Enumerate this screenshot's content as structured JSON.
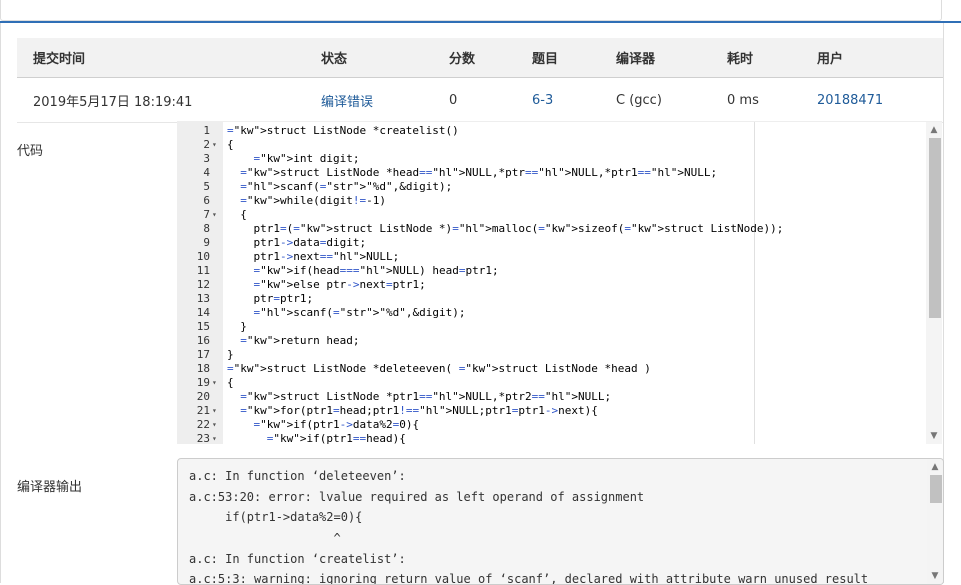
{
  "table": {
    "headers": [
      "提交时间",
      "状态",
      "分数",
      "题目",
      "编译器",
      "耗时",
      "用户"
    ],
    "row": {
      "time": "2019年5月17日 18:19:41",
      "status": "编译错误",
      "score": "0",
      "problem": "6-3",
      "compiler": "C (gcc)",
      "elapsed": "0 ms",
      "user": "20188471"
    }
  },
  "labels": {
    "code": "代码",
    "compiler_output": "编译器输出"
  },
  "code_lines": [
    {
      "n": "1",
      "fold": "",
      "t": "struct ListNode *createlist()"
    },
    {
      "n": "2",
      "fold": "▾",
      "t": "{"
    },
    {
      "n": "3",
      "fold": "",
      "t": "    int digit;"
    },
    {
      "n": "4",
      "fold": "",
      "t": "  struct ListNode *head=NULL,*ptr=NULL,*ptr1=NULL;"
    },
    {
      "n": "5",
      "fold": "",
      "t": "  scanf(\"%d\",&digit);"
    },
    {
      "n": "6",
      "fold": "",
      "t": "  while(digit!=-1)"
    },
    {
      "n": "7",
      "fold": "▾",
      "t": "  {"
    },
    {
      "n": "8",
      "fold": "",
      "t": "    ptr1=(struct ListNode *)malloc(sizeof(struct ListNode));"
    },
    {
      "n": "9",
      "fold": "",
      "t": "    ptr1->data=digit;"
    },
    {
      "n": "10",
      "fold": "",
      "t": "    ptr1->next=NULL;"
    },
    {
      "n": "11",
      "fold": "",
      "t": "    if(head==NULL) head=ptr1;"
    },
    {
      "n": "12",
      "fold": "",
      "t": "    else ptr->next=ptr1;"
    },
    {
      "n": "13",
      "fold": "",
      "t": "    ptr=ptr1;"
    },
    {
      "n": "14",
      "fold": "",
      "t": "    scanf(\"%d\",&digit);"
    },
    {
      "n": "15",
      "fold": "",
      "t": "  }"
    },
    {
      "n": "16",
      "fold": "",
      "t": "  return head;"
    },
    {
      "n": "17",
      "fold": "",
      "t": "}"
    },
    {
      "n": "18",
      "fold": "",
      "t": "struct ListNode *deleteeven( struct ListNode *head )"
    },
    {
      "n": "19",
      "fold": "▾",
      "t": "{"
    },
    {
      "n": "20",
      "fold": "",
      "t": "  struct ListNode *ptr1=NULL,*ptr2=NULL;"
    },
    {
      "n": "21",
      "fold": "▾",
      "t": "  for(ptr1=head;ptr1!=NULL;ptr1=ptr1->next){"
    },
    {
      "n": "22",
      "fold": "▾",
      "t": "    if(ptr1->data%2=0){"
    },
    {
      "n": "23",
      "fold": "▾",
      "t": "      if(ptr1==head){"
    }
  ],
  "compiler_output": [
    "a.c: In function ‘deleteeven’:",
    "a.c:53:20: error: lvalue required as left operand of assignment",
    "     if(ptr1->data%2=0){",
    "                    ^",
    "a.c: In function ‘createlist’:",
    "a.c:5:3: warning: ignoring return value of ‘scanf’, declared with attribute warn_unused_result"
  ],
  "code_scroll": {
    "position": 0,
    "visible_fraction": 0.62
  },
  "output_scroll": {
    "position": 0,
    "visible_fraction": 0.3
  }
}
